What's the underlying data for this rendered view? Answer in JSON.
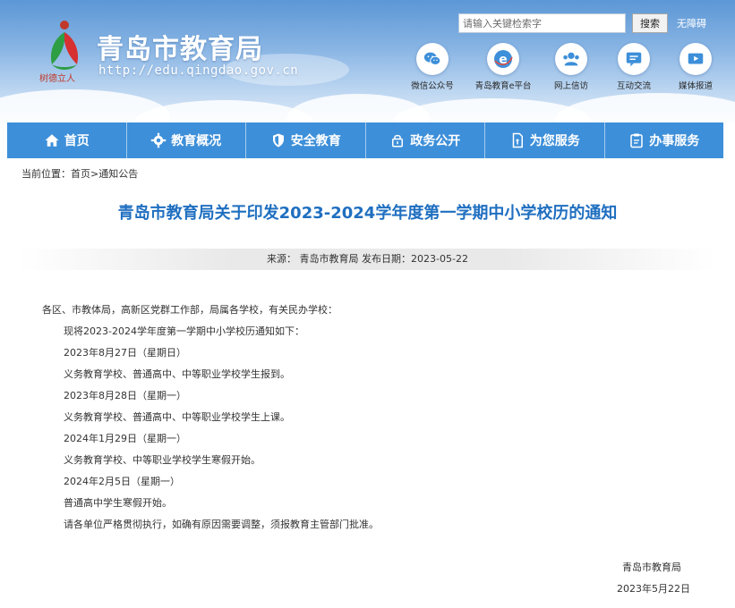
{
  "header": {
    "site_title": "青岛市教育局",
    "site_url": "http://edu.qingdao.gov.cn",
    "slogan": "树德立人",
    "search_placeholder": "请输入关键检索字",
    "search_button": "搜索",
    "accessibility_link": "无障碍",
    "quick_links": [
      {
        "label": "微信公众号",
        "icon": "wechat-icon"
      },
      {
        "label": "青岛教育e平台",
        "icon": "e-platform-icon"
      },
      {
        "label": "网上信访",
        "icon": "users-icon"
      },
      {
        "label": "互动交流",
        "icon": "chat-icon"
      },
      {
        "label": "媒体报道",
        "icon": "video-icon"
      }
    ]
  },
  "nav": {
    "items": [
      {
        "label": "首页",
        "icon": "home-icon"
      },
      {
        "label": "教育概况",
        "icon": "gear-icon"
      },
      {
        "label": "安全教育",
        "icon": "shield-icon"
      },
      {
        "label": "政务公开",
        "icon": "lock-icon"
      },
      {
        "label": "为您服务",
        "icon": "document-icon"
      },
      {
        "label": "办事服务",
        "icon": "clipboard-icon"
      }
    ]
  },
  "breadcrumb": {
    "prefix": "当前位置：",
    "home": "首页",
    "separator": ">",
    "current": "通知公告"
  },
  "article": {
    "title": "青岛市教育局关于印发2023-2024学年度第一学期中小学校历的通知",
    "meta": "来源： 青岛市教育局 发布日期：2023-05-22",
    "salutation": "各区、市教体局，高新区党群工作部，局属各学校，有关民办学校：",
    "lines": [
      "现将2023-2024学年度第一学期中小学校历通知如下：",
      "2023年8月27日（星期日）",
      "义务教育学校、普通高中、中等职业学校学生报到。",
      "2023年8月28日（星期一）",
      "义务教育学校、普通高中、中等职业学校学生上课。",
      "2024年1月29日（星期一）",
      "义务教育学校、中等职业学校学生寒假开始。",
      "2024年2月5日（星期一）",
      "普通高中学生寒假开始。",
      "请各单位严格贯彻执行，如确有原因需要调整，须报教育主管部门批准。"
    ],
    "signature": "青岛市教育局",
    "date": "2023年5月22日"
  },
  "colors": {
    "nav_bg": "#3d8fd9",
    "title": "#1f6fc0",
    "banner_top": "#5c97d6",
    "banner_bottom": "#dfebf8"
  }
}
